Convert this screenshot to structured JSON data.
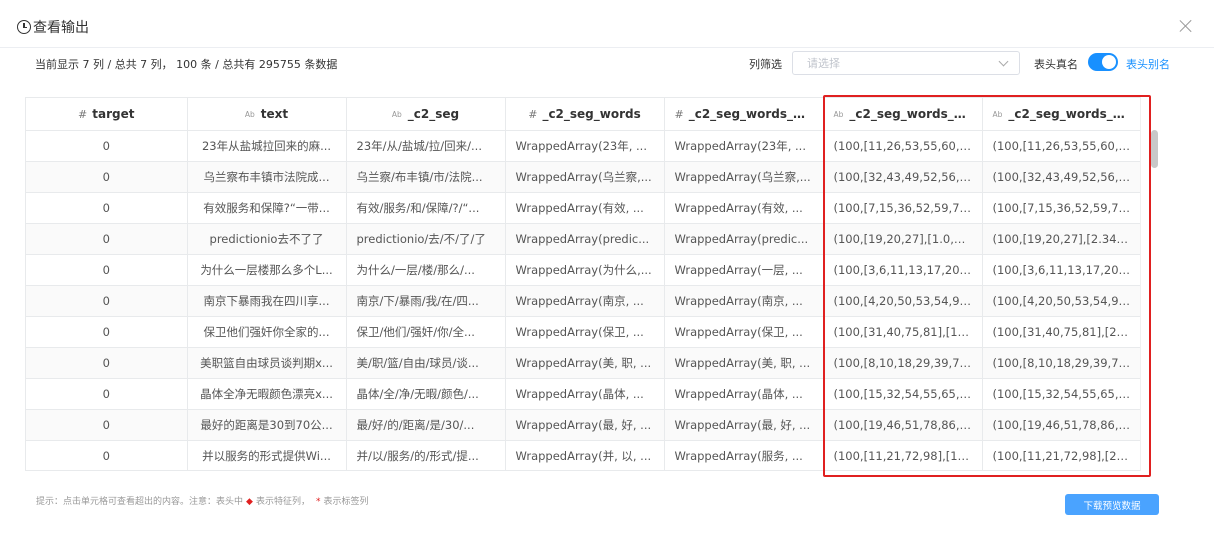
{
  "dialog": {
    "title": "查看输出",
    "summary": "当前显示 7 列 / 总共 7 列， 100 条 / 总共有 295755 条数据"
  },
  "filter": {
    "label": "列筛选",
    "placeholder": "请选择"
  },
  "header_toggle": {
    "left_label": "表头真名",
    "right_label": "表头别名",
    "on": true
  },
  "table": {
    "columns": [
      {
        "type_icon": "#",
        "label": "target"
      },
      {
        "type_icon": "Ab",
        "label": "text"
      },
      {
        "type_icon": "Ab",
        "label": "_c2_seg"
      },
      {
        "type_icon": "#",
        "label": "_c2_seg_words"
      },
      {
        "type_icon": "#",
        "label": "_c2_seg_words_fil..."
      },
      {
        "type_icon": "Ab",
        "label": "_c2_seg_words_fil..."
      },
      {
        "type_icon": "Ab",
        "label": "_c2_seg_words_filt..."
      }
    ],
    "rows": [
      [
        "0",
        "23年从盐城拉回来的麻...",
        "23年/从/盐城/拉/回来/...",
        "WrappedArray(23年, ...",
        "WrappedArray(23年, ...",
        "(100,[11,26,53,55,60,6...",
        "(100,[11,26,53,55,60,6..."
      ],
      [
        "0",
        "乌兰察布丰镇市法院成...",
        "乌兰察/布丰镇/市/法院...",
        "WrappedArray(乌兰察,...",
        "WrappedArray(乌兰察,...",
        "(100,[32,43,49,52,56,6...",
        "(100,[32,43,49,52,56,6..."
      ],
      [
        "0",
        "有效服务和保障?“一带...",
        "有效/服务/和/保障/?/“...",
        "WrappedArray(有效, ...",
        "WrappedArray(有效, ...",
        "(100,[7,15,36,52,59,70,...",
        "(100,[7,15,36,52,59,70,..."
      ],
      [
        "0",
        "predictionio去不了了",
        "predictionio/去/不/了/了",
        "WrappedArray(predic...",
        "WrappedArray(predic...",
        "(100,[19,20,27],[1.0,1.0...",
        "(100,[19,20,27],[2.345..."
      ],
      [
        "0",
        "为什么一层楼那么多个L...",
        "为什么/一层/楼/那么/...",
        "WrappedArray(为什么,...",
        "WrappedArray(一层, ...",
        "(100,[3,6,11,13,17,20,2...",
        "(100,[3,6,11,13,17,20,2..."
      ],
      [
        "0",
        "南京下暴雨我在四川享...",
        "南京/下/暴雨/我/在/四...",
        "WrappedArray(南京, ...",
        "WrappedArray(南京, ...",
        "(100,[4,20,50,53,54,94]...",
        "(100,[4,20,50,53,54,94]..."
      ],
      [
        "0",
        "保卫他们强奸你全家的...",
        "保卫/他们/强奸/你/全...",
        "WrappedArray(保卫, ...",
        "WrappedArray(保卫, ...",
        "(100,[31,40,75,81],[1.0,...",
        "(100,[31,40,75,81],[2.2..."
      ],
      [
        "0",
        "美职篮自由球员谈判期x...",
        "美/职/篮/自由/球员/谈...",
        "WrappedArray(美, 职, ...",
        "WrappedArray(美, 职, ...",
        "(100,[8,10,18,29,39,70,...",
        "(100,[8,10,18,29,39,70,..."
      ],
      [
        "0",
        "晶体全净无暇颜色漂亮x...",
        "晶体/全/净/无暇/颜色/...",
        "WrappedArray(晶体, ...",
        "WrappedArray(晶体, ...",
        "(100,[15,32,54,55,65,7...",
        "(100,[15,32,54,55,65,7..."
      ],
      [
        "0",
        "最好的距离是30到70公...",
        "最/好/的/距离/是/30/...",
        "WrappedArray(最, 好, ...",
        "WrappedArray(最, 好, ...",
        "(100,[19,46,51,78,86,9...",
        "(100,[19,46,51,78,86,9..."
      ],
      [
        "0",
        "并以服务的形式提供Wi...",
        "并/以/服务/的/形式/提...",
        "WrappedArray(并, 以, ...",
        "WrappedArray(服务, ...",
        "(100,[11,21,72,98],[1.0,...",
        "(100,[11,21,72,98],[2.3..."
      ]
    ]
  },
  "footer": {
    "hint_prefix": "提示：点击单元格可查看超出的内容。注意：表头中",
    "hint_feature": "表示特征列，",
    "hint_star": "*",
    "hint_label": "表示标签列",
    "download_label": "下载预览数据"
  },
  "colors": {
    "accent": "#1890ff",
    "highlight": "#e02020"
  }
}
